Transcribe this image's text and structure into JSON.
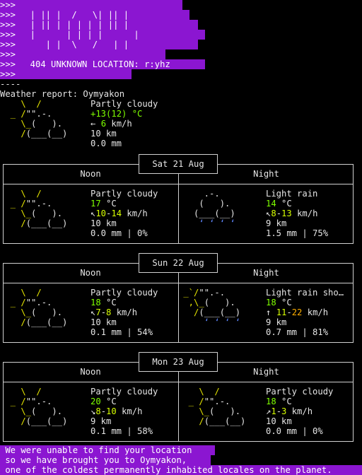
{
  "banner": {
    "prompt_lines": [
      ">>>",
      ">>>",
      ">>>",
      ">>>",
      ">>>",
      ">>>",
      ">>>",
      ">>>"
    ],
    "art_lines": [
      "",
      "  | || |  /   \\| || |",
      "  | || | | | | | || |",
      "  |      | | | |      |",
      "     | |  \\   /   | |",
      "",
      "  404 UNKNOWN LOCATION: r:yhz",
      ""
    ]
  },
  "separator": "----",
  "current": {
    "title": "Weather report: Oymyakon",
    "condition": "Partly cloudy",
    "temp_prefix": "+13(",
    "temp_feels": "12",
    "temp_suffix": ") °C",
    "wind_arrow": "←",
    "wind_speed": "6",
    "wind_unit": "km/h",
    "visibility": "10 km",
    "precip": "0.0 mm"
  },
  "days": [
    {
      "date": "Sat 21 Aug",
      "noon": {
        "label": "Noon",
        "condition": "Partly cloudy",
        "temp": "17",
        "unit": "°C",
        "arrow": "↖",
        "wind_lo": "10",
        "wind_hi": "14",
        "wind_unit": "km/h",
        "visibility": "10 km",
        "precip": "0.0 mm | 0%"
      },
      "night": {
        "label": "Night",
        "condition": "Light rain",
        "temp": "14",
        "unit": "°C",
        "arrow": "↖",
        "wind_lo": "8",
        "wind_hi": "13",
        "wind_unit": "km/h",
        "visibility": "9 km",
        "precip": "1.5 mm | 75%"
      }
    },
    {
      "date": "Sun 22 Aug",
      "noon": {
        "label": "Noon",
        "condition": "Partly cloudy",
        "temp": "18",
        "unit": "°C",
        "arrow": "↖",
        "wind_lo": "7",
        "wind_hi": "8",
        "wind_unit": "km/h",
        "visibility": "10 km",
        "precip": "0.1 mm | 54%"
      },
      "night": {
        "label": "Night",
        "condition": "Light rain sho…",
        "temp": "18",
        "unit": "°C",
        "arrow": "↑",
        "wind_lo": "11",
        "wind_hi": "22",
        "wind_unit": "km/h",
        "visibility": "9 km",
        "precip": "0.7 mm | 81%"
      }
    },
    {
      "date": "Mon 23 Aug",
      "noon": {
        "label": "Noon",
        "condition": "Partly cloudy",
        "temp": "20",
        "unit": "°C",
        "arrow": "↘",
        "wind_lo": "8",
        "wind_hi": "10",
        "wind_unit": "km/h",
        "visibility": "9 km",
        "precip": "0.1 mm | 58%"
      },
      "night": {
        "label": "Night",
        "condition": "Partly cloudy",
        "temp": "18",
        "unit": "°C",
        "arrow": "↗",
        "wind_lo": "1",
        "wind_hi": "3",
        "wind_unit": "km/h",
        "visibility": "10 km",
        "precip": "0.0 mm | 0%"
      }
    }
  ],
  "footer": {
    "line1": " We were unable to find your location",
    "line2": " so we have brought you to Oymyakon,",
    "line3": " one of the coldest permanently inhabited locales on the planet."
  },
  "colors": {
    "banner": "#8b16d1",
    "temp": "#7fff00",
    "sun": "#e6e600",
    "rain": "#5f87ff"
  }
}
